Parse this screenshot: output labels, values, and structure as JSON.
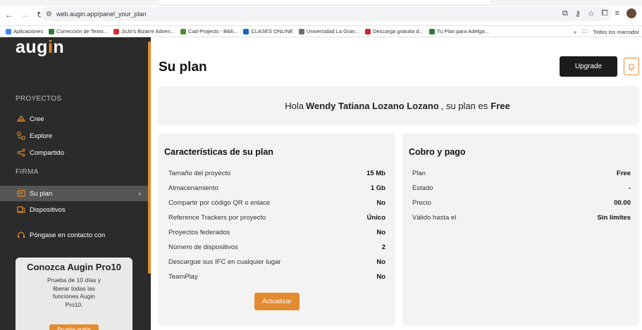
{
  "browser": {
    "url": "web.augin.app/panel_your_plan",
    "bookmarks": [
      {
        "label": "Aplicaciones",
        "color": "#4285f4"
      },
      {
        "label": "Corrección de Texto...",
        "color": "#2e7d32"
      },
      {
        "label": "JoJo's Bizarre Adven...",
        "color": "#d32f2f"
      },
      {
        "label": "Cad-Projects - Bibli...",
        "color": "#558b2f"
      },
      {
        "label": "CLASES ONLINE",
        "color": "#1565c0"
      },
      {
        "label": "Universidad La Gran...",
        "color": "#6d6d6d"
      },
      {
        "label": "Descarga gratuita d...",
        "color": "#c62828"
      },
      {
        "label": "Tu Plan para Adelga...",
        "color": "#2e7d32"
      }
    ],
    "bookmarks_more": "»",
    "all_bookmarks": "Todos los marcador"
  },
  "sidebar": {
    "logo": "augin",
    "section_projects": "PROYECTOS",
    "items_projects": [
      {
        "label": "Cree",
        "icon": "create-icon"
      },
      {
        "label": "Explore",
        "icon": "explore-icon"
      },
      {
        "label": "Compartido",
        "icon": "share-icon"
      }
    ],
    "section_firm": "FIRMA",
    "items_firm": [
      {
        "label": "Su plan",
        "icon": "plan-icon",
        "active": true
      },
      {
        "label": "Dispositivos",
        "icon": "devices-icon"
      }
    ],
    "contact": {
      "label": "Póngase en contacto con",
      "icon": "headset-icon"
    },
    "promo": {
      "title": "Conozca Augin Pro10",
      "text": "Prueba de 10 días y liberar todas las funciones Augin Pro10.",
      "button": "Pruebe gratis"
    }
  },
  "header": {
    "title": "Su plan",
    "upgrade_label": "Upgrade"
  },
  "greeting": {
    "prefix": "Hola",
    "name": "Wendy Tatiana Lozano Lozano",
    "middle": ", su plan es",
    "plan": "Free"
  },
  "features": {
    "title": "Características de su plan",
    "rows": [
      {
        "label": "Tamaño del proyecto",
        "value": "15 Mb"
      },
      {
        "label": "Almacenamiento",
        "value": "1 Gb"
      },
      {
        "label": "Compartir por código QR o enlace",
        "value": "No"
      },
      {
        "label": "Reference Trackers por proyecto",
        "value": "Único"
      },
      {
        "label": "Proyectos federados",
        "value": "No"
      },
      {
        "label": "Número de dispositivos",
        "value": "2"
      },
      {
        "label": "Descargue sus IFC en cualquier lugar",
        "value": "No"
      },
      {
        "label": "TeamPlay",
        "value": "No"
      }
    ],
    "button": "Actualizar"
  },
  "billing": {
    "title": "Cobro y pago",
    "rows": [
      {
        "label": "Plan",
        "value": "Free"
      },
      {
        "label": "Estado",
        "value": "-"
      },
      {
        "label": "Precio",
        "value": "00.00"
      },
      {
        "label": "Válido hasta el",
        "value": "Sin límites"
      }
    ]
  },
  "colors": {
    "accent": "#e38b2f",
    "sidebar": "#2b2b2b",
    "card": "#f3f3f3"
  }
}
